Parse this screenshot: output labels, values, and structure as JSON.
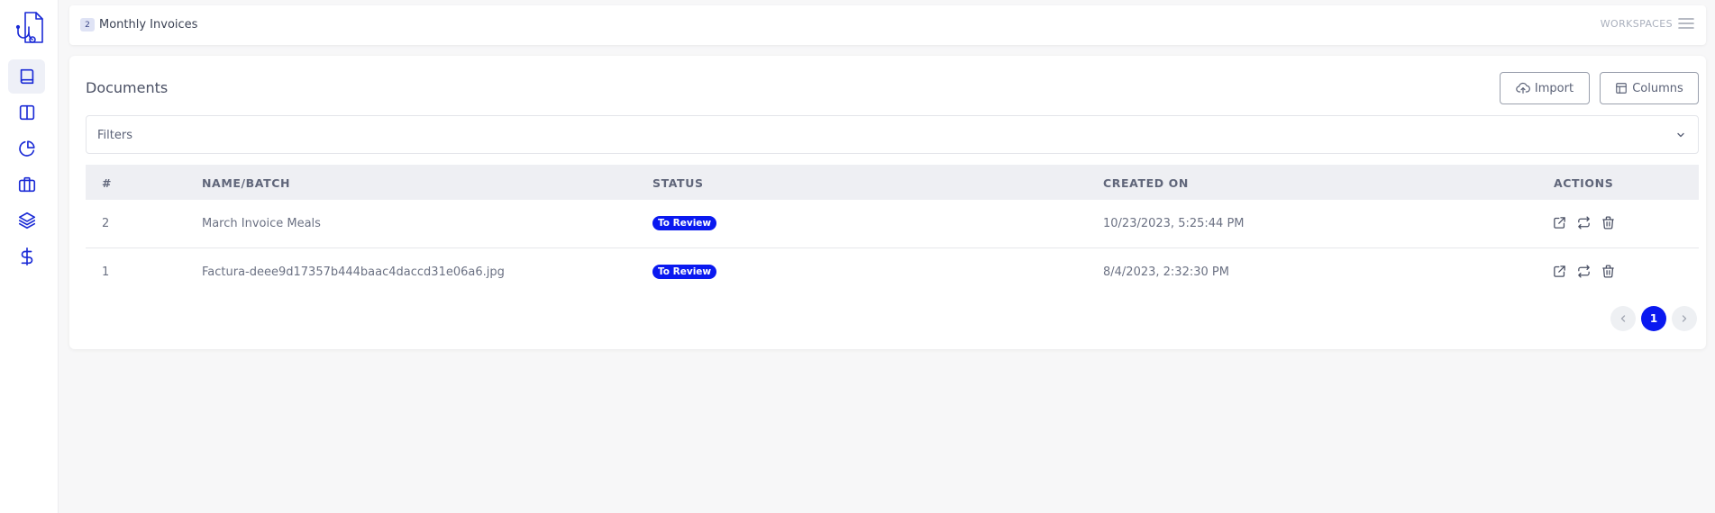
{
  "workspace": {
    "badge": "2",
    "name": "Monthly Invoices",
    "switcher_label": "WORKSPACES"
  },
  "sidebar": {
    "items": [
      {
        "icon": "book-icon",
        "active": true
      },
      {
        "icon": "columns-icon",
        "active": false
      },
      {
        "icon": "pie-chart-icon",
        "active": false
      },
      {
        "icon": "briefcase-icon",
        "active": false
      },
      {
        "icon": "layers-icon",
        "active": false
      },
      {
        "icon": "dollar-icon",
        "active": false
      }
    ]
  },
  "main": {
    "title": "Documents",
    "import_label": "Import",
    "columns_label": "Columns",
    "filters_label": "Filters",
    "table": {
      "headers": [
        "#",
        "NAME/BATCH",
        "STATUS",
        "CREATED ON",
        "ACTIONS"
      ],
      "rows": [
        {
          "id": "2",
          "name": "March Invoice Meals",
          "status": "To Review",
          "created": "10/23/2023, 5:25:44 PM"
        },
        {
          "id": "1",
          "name": "Factura-deee9d17357b444baac4daccd31e06a6.jpg",
          "status": "To Review",
          "created": "8/4/2023, 2:32:30 PM"
        }
      ]
    },
    "pagination": {
      "current_page": "1"
    }
  },
  "colors": {
    "accent": "#0a19f0",
    "icon": "#1a2ad6"
  }
}
